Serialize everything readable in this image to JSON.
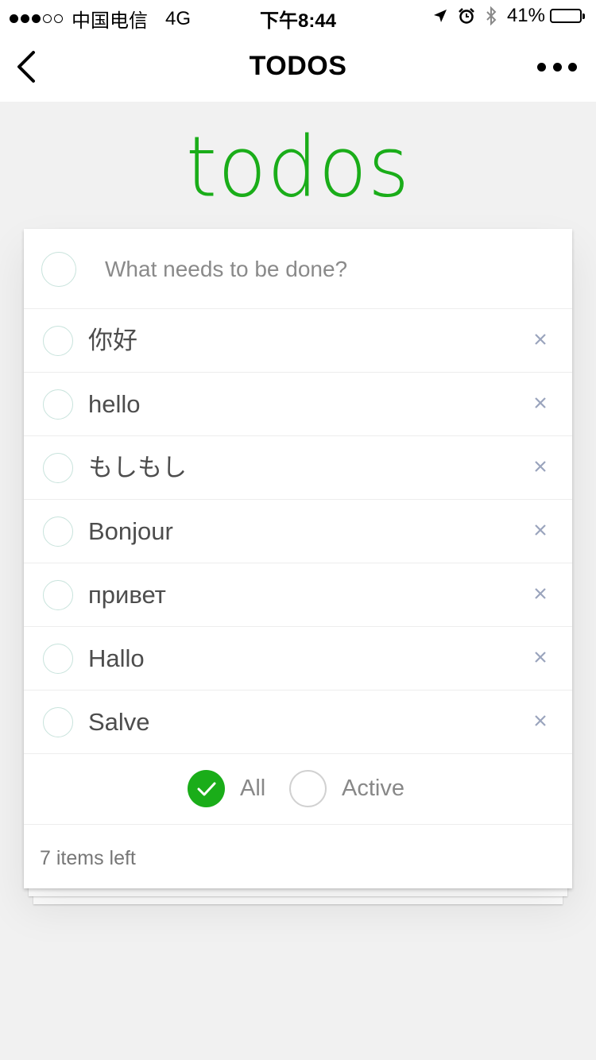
{
  "status_bar": {
    "carrier": "中国电信",
    "network": "4G",
    "time": "下午8:44",
    "battery_percent_label": "41%",
    "battery_level": 0.41,
    "signal_bars_filled": 3,
    "signal_bars_total": 5
  },
  "nav": {
    "title": "TODOS"
  },
  "app": {
    "heading": "todos",
    "accent_color": "#1aad19",
    "new_todo_placeholder": "What needs to be done?"
  },
  "todos": [
    {
      "label": "你好",
      "completed": false
    },
    {
      "label": "hello",
      "completed": false
    },
    {
      "label": "もしもし",
      "completed": false
    },
    {
      "label": "Bonjour",
      "completed": false
    },
    {
      "label": "привет",
      "completed": false
    },
    {
      "label": "Hallo",
      "completed": false
    },
    {
      "label": "Salve",
      "completed": false
    }
  ],
  "filters": [
    {
      "label": "All",
      "selected": true
    },
    {
      "label": "Active",
      "selected": false
    }
  ],
  "footer": {
    "items_left": "7 items left"
  }
}
